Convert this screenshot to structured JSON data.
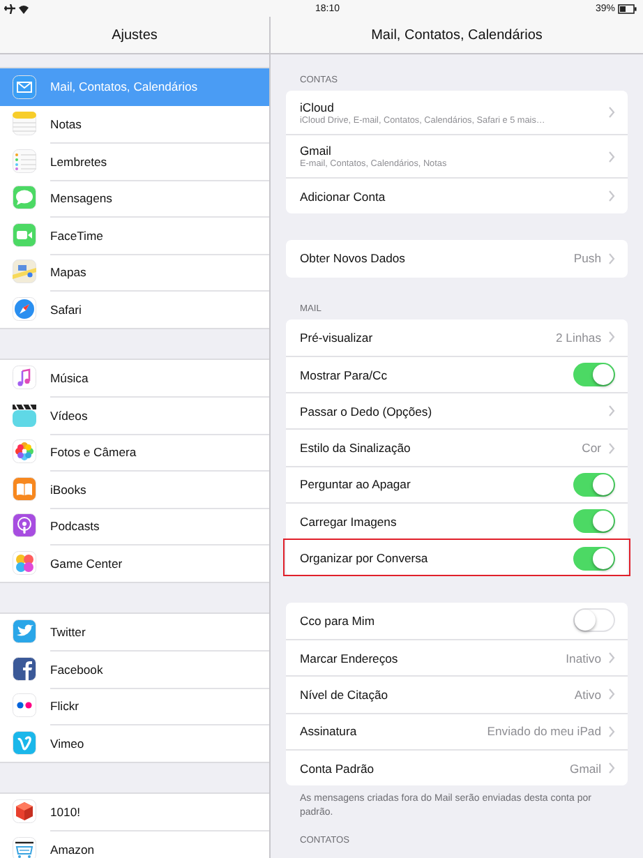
{
  "status_bar": {
    "time": "18:10",
    "battery": "39%"
  },
  "sidebar": {
    "title": "Ajustes",
    "groups": [
      [
        {
          "label": "Mail, Contatos, Calendários",
          "selected": true
        },
        {
          "label": "Notas",
          "selected": false
        },
        {
          "label": "Lembretes",
          "selected": false
        },
        {
          "label": "Mensagens",
          "selected": false
        },
        {
          "label": "FaceTime",
          "selected": false
        },
        {
          "label": "Mapas",
          "selected": false
        },
        {
          "label": "Safari",
          "selected": false
        }
      ],
      [
        {
          "label": "Música",
          "selected": false
        },
        {
          "label": "Vídeos",
          "selected": false
        },
        {
          "label": "Fotos e Câmera",
          "selected": false
        },
        {
          "label": "iBooks",
          "selected": false
        },
        {
          "label": "Podcasts",
          "selected": false
        },
        {
          "label": "Game Center",
          "selected": false
        }
      ],
      [
        {
          "label": "Twitter",
          "selected": false
        },
        {
          "label": "Facebook",
          "selected": false
        },
        {
          "label": "Flickr",
          "selected": false
        },
        {
          "label": "Vimeo",
          "selected": false
        }
      ],
      [
        {
          "label": "1010!",
          "selected": false
        },
        {
          "label": "Amazon",
          "selected": false
        }
      ]
    ]
  },
  "detail": {
    "title": "Mail, Contatos, Calendários",
    "sections": [
      {
        "header": "CONTAS",
        "rows": [
          {
            "kind": "account",
            "label": "iCloud",
            "subtitle": "iCloud Drive, E-mail, Contatos, Calendários, Safari e 5 mais…"
          },
          {
            "kind": "account",
            "label": "Gmail",
            "subtitle": "E-mail, Contatos, Calendários, Notas"
          },
          {
            "kind": "link",
            "label": "Adicionar Conta"
          }
        ]
      },
      {
        "rows": [
          {
            "kind": "link",
            "label": "Obter Novos Dados",
            "value": "Push"
          }
        ]
      },
      {
        "header": "MAIL",
        "rows": [
          {
            "kind": "link",
            "label": "Pré-visualizar",
            "value": "2 Linhas"
          },
          {
            "kind": "toggle",
            "label": "Mostrar Para/Cc",
            "on": true
          },
          {
            "kind": "link",
            "label": "Passar o Dedo (Opções)"
          },
          {
            "kind": "link",
            "label": "Estilo da Sinalização",
            "value": "Cor"
          },
          {
            "kind": "toggle",
            "label": "Perguntar ao Apagar",
            "on": true
          },
          {
            "kind": "toggle",
            "label": "Carregar Imagens",
            "on": true
          },
          {
            "kind": "toggle",
            "label": "Organizar por Conversa",
            "on": true,
            "highlighted": true
          }
        ]
      },
      {
        "rows": [
          {
            "kind": "toggle",
            "label": "Cco para Mim",
            "on": false
          },
          {
            "kind": "link",
            "label": "Marcar Endereços",
            "value": "Inativo"
          },
          {
            "kind": "link",
            "label": "Nível de Citação",
            "value": "Ativo"
          },
          {
            "kind": "link",
            "label": "Assinatura",
            "value": "Enviado do meu iPad"
          },
          {
            "kind": "link",
            "label": "Conta Padrão",
            "value": "Gmail"
          }
        ],
        "footer": "As mensagens criadas fora do Mail serão enviadas desta conta por padrão."
      },
      {
        "header": "CONTATOS"
      }
    ]
  }
}
